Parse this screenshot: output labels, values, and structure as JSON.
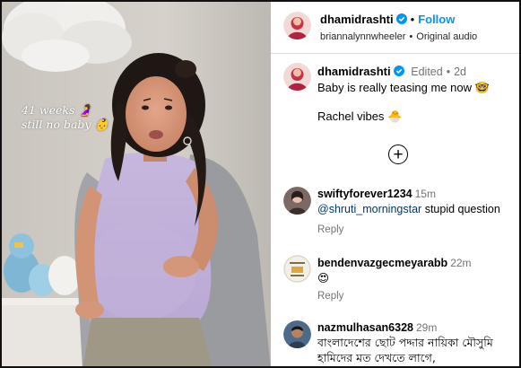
{
  "media": {
    "overlay_line1": "41 weeks 🤰",
    "overlay_line2": "still no baby 👶"
  },
  "header": {
    "username": "dhamidrashti",
    "follow_label": "Follow",
    "audio_user": "briannalynnwheeler",
    "audio_label": "Original audio",
    "separator": "•"
  },
  "caption": {
    "username": "dhamidrashti",
    "edited": "Edited",
    "separator": "•",
    "time": "2d",
    "text1": "Baby is really teasing me now 🤓",
    "text2": "Rachel vibes 🐣",
    "more_symbol": "+"
  },
  "comments": [
    {
      "username": "swiftyforever1234",
      "time": "15m",
      "mention": "@shruti_morningstar",
      "text": " stupid question",
      "reply": "Reply"
    },
    {
      "username": "bendenvazgecmeyarabb",
      "time": "22m",
      "text": "😍",
      "reply": "Reply"
    },
    {
      "username": "nazmulhasan6328",
      "time": "29m",
      "text_line1": "বাংলাদেশের ছোট পদ্দার নায়িকা মৌসুমি",
      "text_line2": "হামিদের মত দেখতে লাগে,"
    }
  ],
  "colors": {
    "follow": "#0095f6",
    "verified": "#0095f6",
    "muted": "#737373",
    "mention": "#00376b"
  }
}
